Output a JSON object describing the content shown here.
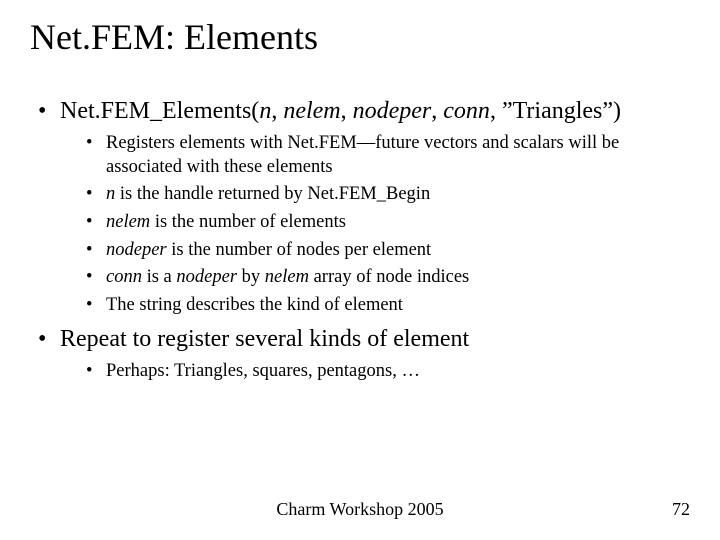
{
  "title": "Net.FEM: Elements",
  "bullets": {
    "b1": {
      "prefix": "Net.FEM_Elements(",
      "arg1": "n",
      "c1": ", ",
      "arg2": "nelem",
      "c2": ", ",
      "arg3": "nodeper",
      "c3": ", ",
      "arg4": "conn",
      "suffix": ", ”Triangles”)",
      "sub": {
        "s1": "Registers elements with Net.FEM—future vectors and scalars will be associated with these elements",
        "s2a": "n",
        "s2b": " is the handle returned by Net.FEM_Begin",
        "s3a": "nelem",
        "s3b": " is the number of elements",
        "s4a": "nodeper",
        "s4b": " is the number of nodes per element",
        "s5a": "conn",
        "s5b": " is a ",
        "s5c": "nodeper",
        "s5d": " by ",
        "s5e": "nelem",
        "s5f": " array of node indices",
        "s6": "The string describes the kind of element"
      }
    },
    "b2": {
      "text": "Repeat to register several kinds of element",
      "sub": {
        "s1": "Perhaps: Triangles, squares, pentagons, …"
      }
    }
  },
  "footer": {
    "center": "Charm Workshop 2005",
    "page": "72"
  }
}
